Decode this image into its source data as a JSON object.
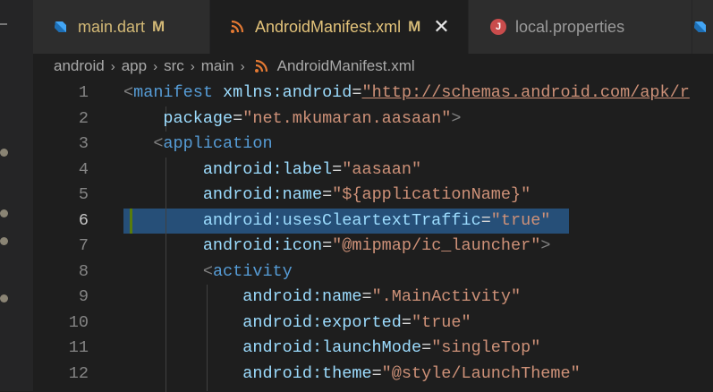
{
  "tabs": [
    {
      "label": "main.dart",
      "badge": "M",
      "icon": "dart-icon",
      "active": false
    },
    {
      "label": "AndroidManifest.xml",
      "badge": "M",
      "icon": "rss-xml-icon",
      "active": true,
      "close": "✕"
    },
    {
      "label": "local.properties",
      "icon": "java-icon",
      "active": false
    },
    {
      "label": "",
      "icon": "dart-icon",
      "active": false
    }
  ],
  "breadcrumb": {
    "items": [
      "android",
      "app",
      "src",
      "main",
      "AndroidManifest.xml"
    ],
    "separator": "›"
  },
  "editor": {
    "current_line": 6,
    "lines": [
      {
        "num": "1",
        "tokens": [
          [
            "punc",
            "<"
          ],
          [
            "tag",
            "manifest"
          ],
          [
            "sp",
            " "
          ],
          [
            "attr",
            "xmlns:android"
          ],
          [
            "eq",
            "="
          ],
          [
            "str",
            "\"http://schemas.android.com/apk/r"
          ]
        ]
      },
      {
        "num": "2",
        "tokens": [
          [
            "sp",
            "    "
          ],
          [
            "attr",
            "package"
          ],
          [
            "eq",
            "="
          ],
          [
            "str",
            "\"net.mkumaran.aasaan\""
          ],
          [
            "punc",
            ">"
          ]
        ]
      },
      {
        "num": "3",
        "tokens": [
          [
            "sp",
            "   "
          ],
          [
            "punc",
            "<"
          ],
          [
            "tag",
            "application"
          ]
        ]
      },
      {
        "num": "4",
        "tokens": [
          [
            "sp",
            "        "
          ],
          [
            "attr",
            "android:label"
          ],
          [
            "eq",
            "="
          ],
          [
            "str",
            "\"aasaan\""
          ]
        ]
      },
      {
        "num": "5",
        "tokens": [
          [
            "sp",
            "        "
          ],
          [
            "attr",
            "android:name"
          ],
          [
            "eq",
            "="
          ],
          [
            "str",
            "\"${applicationName}\""
          ]
        ]
      },
      {
        "num": "6",
        "tokens": [
          [
            "sp",
            "        "
          ],
          [
            "attr",
            "android:usesCleartextTraffic"
          ],
          [
            "eq",
            "="
          ],
          [
            "str",
            "\"true\""
          ]
        ]
      },
      {
        "num": "7",
        "tokens": [
          [
            "sp",
            "        "
          ],
          [
            "attr",
            "android:icon"
          ],
          [
            "eq",
            "="
          ],
          [
            "str",
            "\"@mipmap/ic_launcher\""
          ],
          [
            "punc",
            ">"
          ]
        ]
      },
      {
        "num": "8",
        "tokens": [
          [
            "sp",
            "        "
          ],
          [
            "punc",
            "<"
          ],
          [
            "tag",
            "activity"
          ]
        ]
      },
      {
        "num": "9",
        "tokens": [
          [
            "sp",
            "            "
          ],
          [
            "attr",
            "android:name"
          ],
          [
            "eq",
            "="
          ],
          [
            "str",
            "\".MainActivity\""
          ]
        ]
      },
      {
        "num": "10",
        "tokens": [
          [
            "sp",
            "            "
          ],
          [
            "attr",
            "android:exported"
          ],
          [
            "eq",
            "="
          ],
          [
            "str",
            "\"true\""
          ]
        ]
      },
      {
        "num": "11",
        "tokens": [
          [
            "sp",
            "            "
          ],
          [
            "attr",
            "android:launchMode"
          ],
          [
            "eq",
            "="
          ],
          [
            "str",
            "\"singleTop\""
          ]
        ]
      },
      {
        "num": "12",
        "tokens": [
          [
            "sp",
            "            "
          ],
          [
            "attr",
            "android:theme"
          ],
          [
            "eq",
            "="
          ],
          [
            "str",
            "\"@style/LaunchTheme\""
          ]
        ]
      }
    ]
  },
  "colors": {
    "background": "#1e1e1e",
    "tag": "#569cd6",
    "attribute": "#9cdcfe",
    "string": "#ce9178",
    "selection": "#264f78",
    "modified_tab_text": "#e3c37a"
  }
}
